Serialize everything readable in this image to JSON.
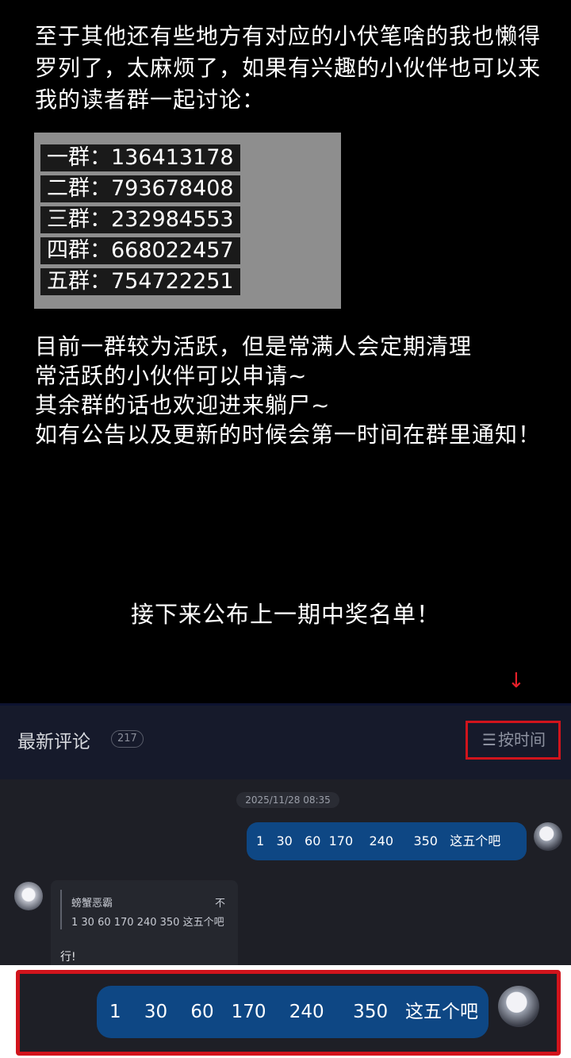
{
  "intro_text": "至于其他还有些地方有对应的小伏笔啥的我也懒得罗列了，太麻烦了，如果有兴趣的小伙伴也可以来我的读者群一起讨论：",
  "groups": [
    {
      "label": "一群：136413178"
    },
    {
      "label": "二群：793678408"
    },
    {
      "label": "三群：232984553"
    },
    {
      "label": "四群：668022457"
    },
    {
      "label": "五群：754722251"
    }
  ],
  "outro_lines": [
    "目前一群较为活跃，但是常满人会定期清理",
    "常活跃的小伙伴可以申请~",
    "其余群的话也欢迎进来躺尸~",
    "如有公告以及更新的时候会第一时间在群里通知！"
  ],
  "announcement": "接下来公布上一期中奖名单！",
  "arrow_glyph": "↓",
  "comments": {
    "title": "最新评论",
    "count": "217",
    "sort_label": "按时间",
    "sort_icon": "list-icon",
    "timestamp": "2025/11/28 08:35",
    "message": "1   30   60  170    240     350   这五个吧",
    "reply": {
      "quote_user": "螃蟹恶霸",
      "quote_flag": "不",
      "quote_text": "1 30 60 170 240 350 这五个吧",
      "text": "行!"
    },
    "highlighted_message": "1    30    60   170    240     350   这五个吧"
  },
  "colors": {
    "highlight_red": "#d1141c",
    "bubble_blue": "#0e4784",
    "group_box_gray": "#8e8e8e"
  }
}
